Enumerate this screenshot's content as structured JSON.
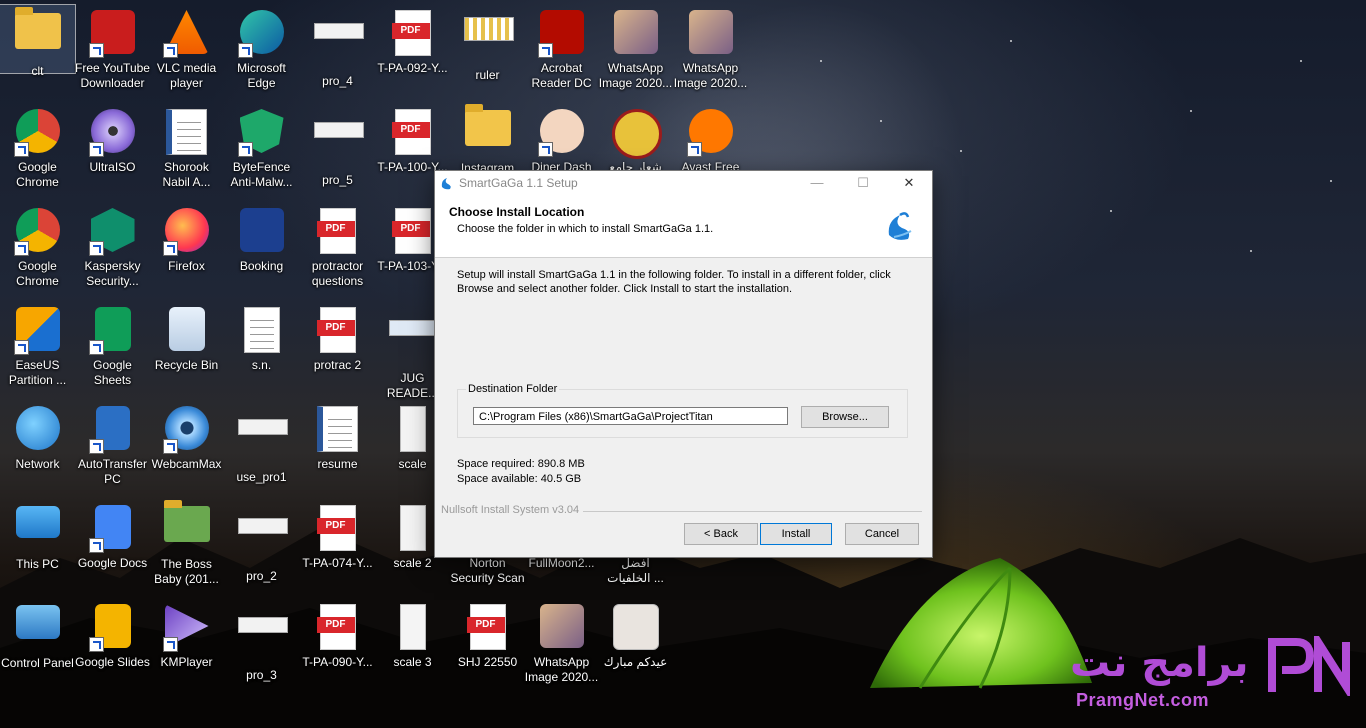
{
  "desktop": {
    "icons": [
      {
        "id": "clt",
        "label": "clt",
        "kind": "folder-user",
        "col": 0,
        "row": 0,
        "selected": true,
        "shortcut": false
      },
      {
        "id": "free-youtube",
        "label": "Free YouTube Downloader",
        "kind": "youtube",
        "col": 1,
        "row": 0,
        "shortcut": true
      },
      {
        "id": "vlc",
        "label": "VLC media player",
        "kind": "vlc",
        "col": 2,
        "row": 0,
        "shortcut": true
      },
      {
        "id": "edge",
        "label": "Microsoft Edge",
        "kind": "edge",
        "col": 3,
        "row": 0,
        "shortcut": true
      },
      {
        "id": "pro4",
        "label": "pro_4",
        "kind": "thumb",
        "col": 4,
        "row": 0
      },
      {
        "id": "tpa092",
        "label": "T-PA-092-Y...",
        "kind": "pdf",
        "col": 5,
        "row": 0
      },
      {
        "id": "ruler",
        "label": "ruler",
        "kind": "thumb-ruler",
        "col": 6,
        "row": 0
      },
      {
        "id": "acrobat",
        "label": "Acrobat Reader DC",
        "kind": "acrobat",
        "col": 7,
        "row": 0,
        "shortcut": true
      },
      {
        "id": "wa1",
        "label": "WhatsApp Image 2020...",
        "kind": "photo",
        "col": 8,
        "row": 0
      },
      {
        "id": "wa2",
        "label": "WhatsApp Image 2020...",
        "kind": "photo",
        "col": 9,
        "row": 0
      },
      {
        "id": "chrome1",
        "label": "Google Chrome",
        "kind": "chrome",
        "col": 0,
        "row": 1,
        "shortcut": true
      },
      {
        "id": "ultraiso",
        "label": "UltraISO",
        "kind": "ultraiso",
        "col": 1,
        "row": 1,
        "shortcut": true
      },
      {
        "id": "shorook",
        "label": "Shorook Nabil A...",
        "kind": "word",
        "col": 2,
        "row": 1
      },
      {
        "id": "bytefence",
        "label": "ByteFence Anti-Malw...",
        "kind": "bytefence",
        "col": 3,
        "row": 1,
        "shortcut": true
      },
      {
        "id": "pro5",
        "label": "pro_5",
        "kind": "thumb",
        "col": 4,
        "row": 1
      },
      {
        "id": "tpa100",
        "label": "T-PA-100-Y...",
        "kind": "pdf",
        "col": 5,
        "row": 1
      },
      {
        "id": "instagram",
        "label": "Instagram",
        "kind": "folder",
        "col": 6,
        "row": 1
      },
      {
        "id": "dinerdash",
        "label": "Diner Dash",
        "kind": "diner",
        "col": 7,
        "row": 1,
        "shortcut": true
      },
      {
        "id": "arabic-doc",
        "label": "شعار جامع",
        "kind": "emblem",
        "col": 8,
        "row": 1
      },
      {
        "id": "avast",
        "label": "Avast Free",
        "kind": "avast",
        "col": 9,
        "row": 1,
        "shortcut": true
      },
      {
        "id": "chrome2",
        "label": "Google Chrome",
        "kind": "chrome",
        "col": 0,
        "row": 2,
        "shortcut": true
      },
      {
        "id": "kaspersky",
        "label": "Kaspersky Security...",
        "kind": "kaspersky",
        "col": 1,
        "row": 2,
        "shortcut": true
      },
      {
        "id": "firefox",
        "label": "Firefox",
        "kind": "firefox",
        "col": 2,
        "row": 2,
        "shortcut": true
      },
      {
        "id": "booking",
        "label": "Booking",
        "kind": "booking",
        "col": 3,
        "row": 2
      },
      {
        "id": "protractor",
        "label": "protractor questions",
        "kind": "pdf",
        "col": 4,
        "row": 2
      },
      {
        "id": "tpa103",
        "label": "T-PA-103-Y...",
        "kind": "pdf",
        "col": 5,
        "row": 2
      },
      {
        "id": "easeus",
        "label": "EaseUS Partition ...",
        "kind": "easeus",
        "col": 0,
        "row": 3,
        "shortcut": true
      },
      {
        "id": "gsheets",
        "label": "Google Sheets",
        "kind": "sheets",
        "col": 1,
        "row": 3,
        "shortcut": true
      },
      {
        "id": "recycle",
        "label": "Recycle Bin",
        "kind": "recycle",
        "col": 2,
        "row": 3
      },
      {
        "id": "sn",
        "label": "s.n.",
        "kind": "doc",
        "col": 3,
        "row": 3
      },
      {
        "id": "protrac2",
        "label": "protrac 2",
        "kind": "pdf",
        "col": 4,
        "row": 3
      },
      {
        "id": "jug",
        "label": "JUG READE...",
        "kind": "thumb-jug",
        "col": 5,
        "row": 3
      },
      {
        "id": "network",
        "label": "Network",
        "kind": "network",
        "col": 0,
        "row": 4
      },
      {
        "id": "autotransfer",
        "label": "AutoTransfer PC",
        "kind": "autotransfer",
        "col": 1,
        "row": 4,
        "shortcut": true
      },
      {
        "id": "webcammax",
        "label": "WebcamMax",
        "kind": "webcam",
        "col": 2,
        "row": 4,
        "shortcut": true
      },
      {
        "id": "usepro1",
        "label": "use_pro1",
        "kind": "thumb",
        "col": 3,
        "row": 4
      },
      {
        "id": "resume",
        "label": "resume",
        "kind": "word",
        "col": 4,
        "row": 4
      },
      {
        "id": "scale",
        "label": "scale",
        "kind": "scale",
        "col": 5,
        "row": 4
      },
      {
        "id": "thispc",
        "label": "This PC",
        "kind": "thispc",
        "col": 0,
        "row": 5
      },
      {
        "id": "gdocs",
        "label": "Google Docs",
        "kind": "docs",
        "col": 1,
        "row": 5,
        "shortcut": true
      },
      {
        "id": "bossbaby",
        "label": "The Boss Baby (201...",
        "kind": "folder-movie",
        "col": 2,
        "row": 5
      },
      {
        "id": "pro2",
        "label": "pro_2",
        "kind": "thumb",
        "col": 3,
        "row": 5
      },
      {
        "id": "tpa074",
        "label": "T-PA-074-Y...",
        "kind": "pdf",
        "col": 4,
        "row": 5
      },
      {
        "id": "scale2",
        "label": "scale 2",
        "kind": "scale",
        "col": 5,
        "row": 5
      },
      {
        "id": "norton",
        "label": "Norton Security Scan",
        "kind": "none",
        "col": 6,
        "row": 5
      },
      {
        "id": "fullmoon",
        "label": "FullMoon2...",
        "kind": "none",
        "col": 7,
        "row": 5
      },
      {
        "id": "afdal",
        "label": "أفضل الخلفيات ...",
        "kind": "none",
        "col": 8,
        "row": 5
      },
      {
        "id": "controlpanel",
        "label": "Control Panel",
        "kind": "controlpanel",
        "col": 0,
        "row": 6
      },
      {
        "id": "gslides",
        "label": "Google Slides",
        "kind": "slides",
        "col": 1,
        "row": 6,
        "shortcut": true
      },
      {
        "id": "kmplayer",
        "label": "KMPlayer",
        "kind": "kmplayer",
        "col": 2,
        "row": 6,
        "shortcut": true
      },
      {
        "id": "pro3",
        "label": "pro_3",
        "kind": "thumb",
        "col": 3,
        "row": 6
      },
      {
        "id": "tpa090",
        "label": "T-PA-090-Y...",
        "kind": "pdf",
        "col": 4,
        "row": 6
      },
      {
        "id": "scale3",
        "label": "scale 3",
        "kind": "scale",
        "col": 5,
        "row": 6
      },
      {
        "id": "shj",
        "label": "SHJ 22550",
        "kind": "pdf",
        "col": 6,
        "row": 6
      },
      {
        "id": "wa3",
        "label": "WhatsApp Image 2020...",
        "kind": "photo",
        "col": 7,
        "row": 6
      },
      {
        "id": "eid",
        "label": "عيدكم مبارك",
        "kind": "eid",
        "col": 8,
        "row": 6
      }
    ]
  },
  "dialog": {
    "window_title": "SmartGaGa 1.1 Setup",
    "minimize_glyph": "—",
    "maximize_glyph": "☐",
    "close_glyph": "✕",
    "header_title": "Choose Install Location",
    "header_subtitle": "Choose the folder in which to install SmartGaGa 1.1.",
    "body_text": "Setup will install SmartGaGa 1.1 in the following folder. To install in a different folder, click Browse and select another folder. Click Install to start the installation.",
    "group_label": "Destination Folder",
    "install_path": "C:\\Program Files (x86)\\SmartGaGa\\ProjectTitan",
    "browse_label": "Browse...",
    "space_required": "Space required: 890.8 MB",
    "space_available": "Space available: 40.5 GB",
    "branding": "Nullsoft Install System v3.04",
    "back_label": "< Back",
    "install_label": "Install",
    "cancel_label": "Cancel"
  },
  "watermark": {
    "arabic": "برامج نت",
    "url": "PramgNet.com",
    "logo_letters": "PN"
  },
  "colors": {
    "accent": "#0078d7",
    "pdf_red": "#d9262b",
    "watermark_purple": "#b04cd6"
  }
}
